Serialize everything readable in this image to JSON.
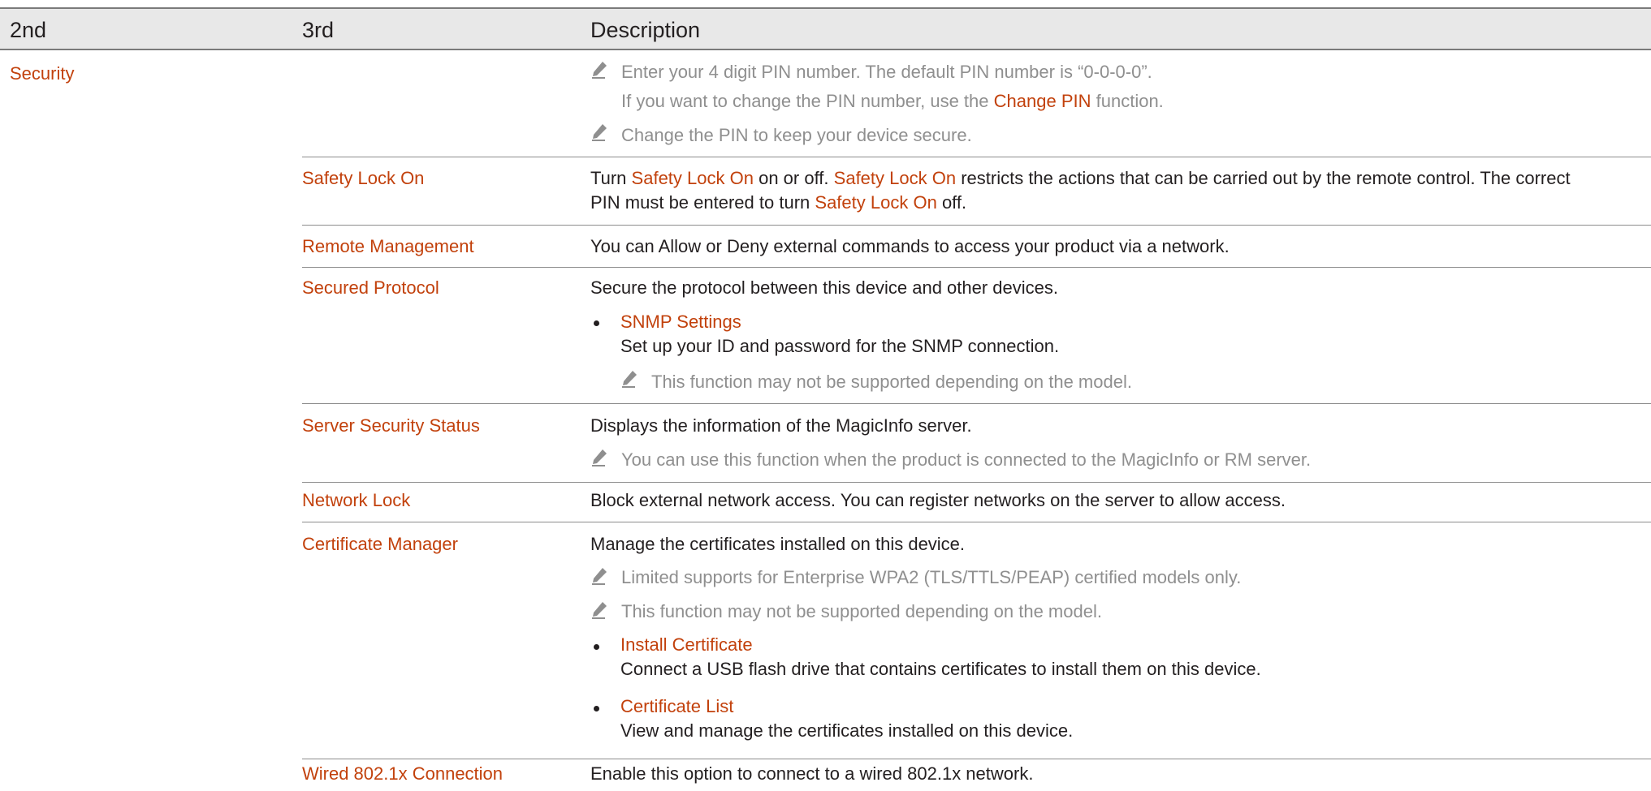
{
  "colors": {
    "accent": "#c2410c",
    "note_text": "#8f8f8f",
    "header_bg": "#e8e8e8"
  },
  "header": {
    "col1": "2nd",
    "col2": "3rd",
    "col3": "Description"
  },
  "security": {
    "label": "Security",
    "pin_note_1a": "Enter your 4 digit PIN number. The default PIN number is “0-0-0-0”.",
    "pin_note_1b_pre": "If you want to change the PIN number, use the",
    "pin_note_1b_link": "Change PIN",
    "pin_note_1b_post": "function.",
    "pin_note_2": "Change the PIN to keep your device secure."
  },
  "rows": {
    "safety": {
      "label": "Safety Lock On",
      "l1_a": "Turn",
      "l1_b": "Safety Lock On",
      "l1_c": "on or off.",
      "l1_d": "Safety Lock On",
      "l1_e": "restricts the actions that can be carried out by the remote control.  The correct",
      "l2_a": "PIN must be entered to turn",
      "l2_b": "Safety Lock On",
      "l2_c": "off."
    },
    "remote": {
      "label": "Remote Management",
      "desc": "You can Allow or Deny external commands to access your product via a network."
    },
    "secured": {
      "label": "Secured Protocol",
      "desc": "Secure the protocol between this device and other devices.",
      "bullet_title": "SNMP Settings",
      "bullet_desc": "Set up your ID and password for the SNMP connection.",
      "note": "This function may not be supported depending on the model."
    },
    "server": {
      "label": "Server Security Status",
      "desc": "Displays the information of the MagicInfo server.",
      "note": "You can use this function when the product is connected to the MagicInfo or RM server."
    },
    "network": {
      "label": "Network Lock",
      "desc": "Block external network access. You can register networks on the server to allow access."
    },
    "cert": {
      "label": "Certificate Manager",
      "desc": "Manage the certificates installed on this device.",
      "note1": "Limited supports for Enterprise WPA2 (TLS/TTLS/PEAP) certified models only.",
      "note2": "This function may not be supported depending on the model.",
      "b1_title": "Install Certificate",
      "b1_desc": "Connect a USB flash drive that contains certificates to install them on this device.",
      "b2_title": "Certificate List",
      "b2_desc": "View and manage the certificates installed on this device."
    },
    "wired": {
      "label": "Wired 802.1x Connection",
      "desc": "Enable this option to connect to a wired 802.1x network."
    }
  }
}
